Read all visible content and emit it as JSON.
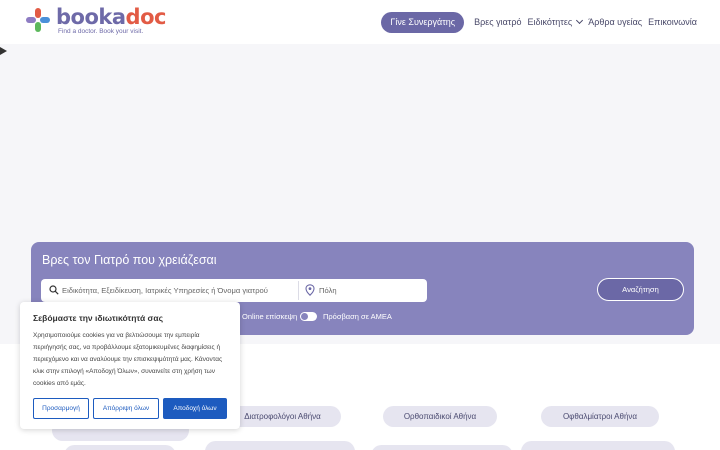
{
  "brand": {
    "name_part1": "booka",
    "name_part2": "doc",
    "tagline": "Find a doctor. Book your visit.",
    "color": "#6e6aa8"
  },
  "nav": {
    "cta": "Γίνε Συνεργάτης",
    "links": [
      "Βρες γιατρό",
      "Ειδικότητες",
      "Άρθρα υγείας",
      "Επικοινωνία"
    ]
  },
  "search": {
    "title": "Βρες τον Γιατρό που χρειάζεσαι",
    "query_placeholder": "Ειδικότητα, Εξειδίκευση, Ιατρικές Υπηρεσίες ή Όνομα γιατρού",
    "city_placeholder": "Πόλη",
    "button": "Αναζήτηση",
    "toggles": [
      "Online επίσκεψη",
      "Πρόσβαση σε ΑΜΕΑ"
    ]
  },
  "specialties": [
    "Διατροφολόγοι Αθήνα",
    "Ορθοπαιδικοί Αθήνα",
    "Οφθαλμίατροι Αθήνα"
  ],
  "cookie": {
    "title": "Σεβόμαστε την ιδιωτικότητά σας",
    "text": "Χρησιμοποιούμε cookies για να βελτιώσουμε την εμπειρία περιήγησής σας, να προβάλλουμε εξατομικευμένες διαφημίσεις ή περιεχόμενο και να αναλύουμε την επισκεψιμότητά μας. Κάνοντας κλικ στην επιλογή «Αποδοχή Όλων», συναινείτε στη χρήση των cookies από εμάς.",
    "customize": "Προσαρμογή",
    "reject": "Απόρριψη όλων",
    "accept": "Αποδοχή όλων"
  }
}
